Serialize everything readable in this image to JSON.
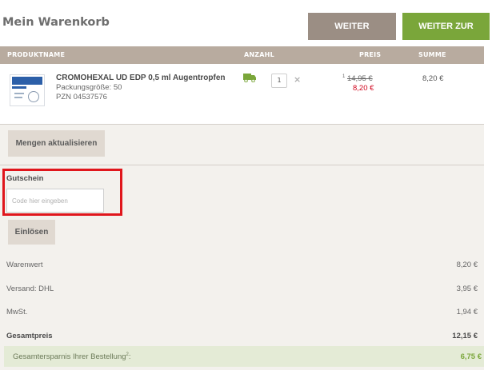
{
  "header": {
    "title": "Mein Warenkorb",
    "continue_shopping": "WEITER EINKAUFEN",
    "checkout": "WEITER ZUR KASSE"
  },
  "table": {
    "columns": {
      "product": "PRODUKTNAME",
      "quantity": "ANZAHL",
      "price": "PREIS",
      "total": "SUMME"
    }
  },
  "product": {
    "name": "CROMOHEXAL UD EDP 0,5 ml Augentropfen",
    "pack_size": "Packungsgröße: 50",
    "pzn": "PZN 04537576",
    "quantity": "1",
    "remove_icon": "×",
    "old_price_marker": "1",
    "old_price": "14,95 €",
    "new_price": "8,20 €",
    "line_total": "8,20 €",
    "icons": {
      "delivery": "truck-icon",
      "remove": "close-icon"
    }
  },
  "actions": {
    "update_quantities": "Mengen aktualisieren",
    "redeem": "Einlösen"
  },
  "coupon": {
    "title": "Gutschein",
    "placeholder": "Code hier eingeben",
    "value": ""
  },
  "summary": {
    "rows": [
      {
        "label": "Warenwert",
        "value": "8,20 €"
      },
      {
        "label": "Versand: DHL",
        "value": "3,95 €"
      },
      {
        "label": "MwSt.",
        "value": "1,94 €"
      },
      {
        "label": "Gesamtpreis",
        "value": "12,15 €"
      }
    ],
    "savings_label": "Gesamtersparnis Ihrer Bestellung",
    "savings_marker": "2",
    "savings_suffix": ":",
    "savings_value": "6,75 €"
  },
  "colors": {
    "accent_green": "#7aa63a",
    "header_brown": "#b8ab9f",
    "button_taupe": "#9b8e84",
    "price_red": "#d0021b",
    "highlight_red": "#e0161c"
  }
}
